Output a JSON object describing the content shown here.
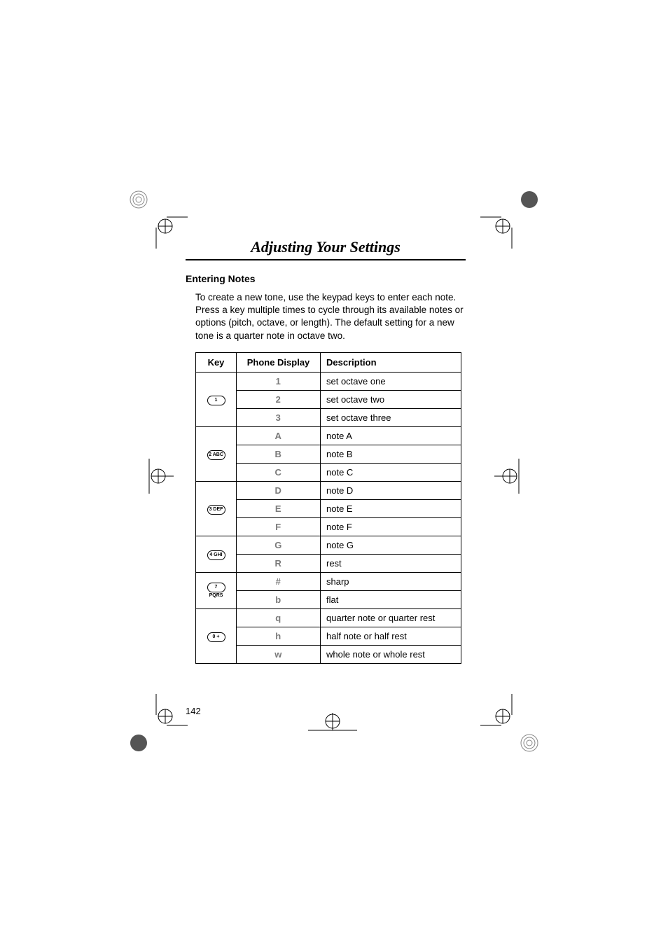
{
  "chapter_title": "Adjusting Your Settings",
  "section_heading": "Entering Notes",
  "intro_text": "To create a new tone, use the keypad keys to enter each note. Press a key multiple times to cycle through its available notes or options (pitch, octave, or length). The default setting for a new tone is a quarter note in octave two.",
  "table": {
    "headers": {
      "key": "Key",
      "display": "Phone Display",
      "description": "Description"
    },
    "rows": [
      {
        "key": "1",
        "display": "1",
        "description": "set octave one"
      },
      {
        "key": "",
        "display": "2",
        "description": "set octave two"
      },
      {
        "key": "",
        "display": "3",
        "description": "set octave three"
      },
      {
        "key": "2 ABC",
        "display": "A",
        "description": "note A"
      },
      {
        "key": "",
        "display": "B",
        "description": "note B"
      },
      {
        "key": "",
        "display": "C",
        "description": "note C"
      },
      {
        "key": "3 DEF",
        "display": "D",
        "description": "note D"
      },
      {
        "key": "",
        "display": "E",
        "description": "note E"
      },
      {
        "key": "",
        "display": "F",
        "description": "note F"
      },
      {
        "key": "4 GHI",
        "display": "G",
        "description": "note G"
      },
      {
        "key": "",
        "display": "R",
        "description": "rest"
      },
      {
        "key": "7 PQRS",
        "display": "#",
        "description": "sharp"
      },
      {
        "key": "",
        "display": "b",
        "description": "flat"
      },
      {
        "key": "0 +",
        "display": "q",
        "description": "quarter note or quarter rest"
      },
      {
        "key": "",
        "display": "h",
        "description": "half note or half rest"
      },
      {
        "key": "",
        "display": "w",
        "description": "whole note or whole rest"
      }
    ]
  },
  "page_number": "142"
}
